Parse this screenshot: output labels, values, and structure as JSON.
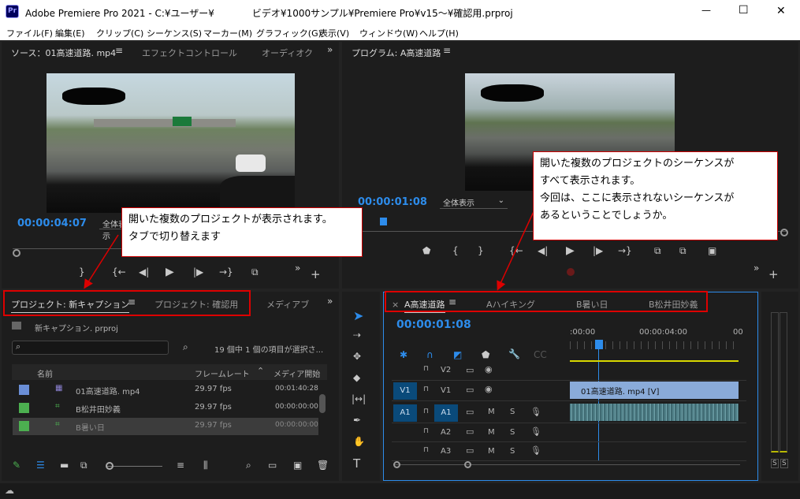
{
  "window": {
    "title": "Adobe Premiere Pro 2021 - C:¥ユーザー¥　　　　ビデオ¥1000サンプル¥Premiere Pro¥v15〜¥確認用.prproj",
    "app_badge": "Pr",
    "minimize": "—",
    "maximize": "☐",
    "close": "✕"
  },
  "menu": [
    "ファイル(F)",
    "編集(E)",
    "クリップ(C)",
    "シーケンス(S)",
    "マーカー(M)",
    "グラフィック(G)",
    "表示(V)",
    "ウィンドウ(W)",
    "ヘルプ(H)"
  ],
  "source": {
    "tabs": [
      "ソース：01高速道路. mp4",
      "エフェクトコントロール",
      "オーディオク"
    ],
    "timecode": "00:00:04:07",
    "fit": "全体表示"
  },
  "program": {
    "tab": "プログラム: A高速道路",
    "timecode": "00:00:01:08",
    "fit": "全体表示"
  },
  "project": {
    "tabs": [
      "プロジェクト: 新キャプション",
      "プロジェクト: 確認用",
      "メディアブ"
    ],
    "file": "新キャプション. prproj",
    "search_placeholder": "",
    "selection_info": "19 個中 1 個の項目が選択さ...",
    "columns": [
      "名前",
      "フレームレート",
      "メディア開始"
    ],
    "rows": [
      {
        "name": "01高速道路. mp4",
        "rate": "29.97 fps",
        "start": "00:01:40:28",
        "color": "#6a8ed6"
      },
      {
        "name": "B松井田妙義",
        "rate": "29.97 fps",
        "start": "00:00:00:00",
        "color": "#4caf50"
      },
      {
        "name": "B暑い日",
        "rate": "29.97 fps",
        "start": "00:00:00:00",
        "color": "#4caf50"
      }
    ]
  },
  "timeline": {
    "tabs": [
      "A高速道路",
      "Aハイキング",
      "B暑い日",
      "B松井田妙義"
    ],
    "close": "×",
    "timecode": "00:00:01:08",
    "ruler": [
      ":00:00",
      "00:00:04:00",
      "00"
    ],
    "tracks": [
      {
        "src": "",
        "name": "V2",
        "lock": "🔒",
        "b1": "▭",
        "b2": "◉",
        "b3": ""
      },
      {
        "src": "V1",
        "name": "V1",
        "lock": "🔒",
        "b1": "▭",
        "b2": "◉",
        "b3": ""
      },
      {
        "src": "A1",
        "name": "A1",
        "lock": "🔒",
        "b1": "▭",
        "b2": "M",
        "b3": "S"
      },
      {
        "src": "",
        "name": "A2",
        "lock": "🔒",
        "b1": "▭",
        "b2": "M",
        "b3": "S"
      },
      {
        "src": "",
        "name": "A3",
        "lock": "🔒",
        "b1": "▭",
        "b2": "M",
        "b3": "S"
      }
    ],
    "clip": "01高速道路. mp4 [V]"
  },
  "meter": {
    "labels": [
      "S",
      "S"
    ]
  },
  "callouts": {
    "left": [
      "開いた複数のプロジェクトが表示されます。",
      "タブで切り替えます"
    ],
    "right": [
      "開いた複数のプロジェクトのシーケンスが",
      "すべて表示されます。",
      "今回は、ここに表示されないシーケンスが",
      "あるということでしょうか。"
    ]
  }
}
